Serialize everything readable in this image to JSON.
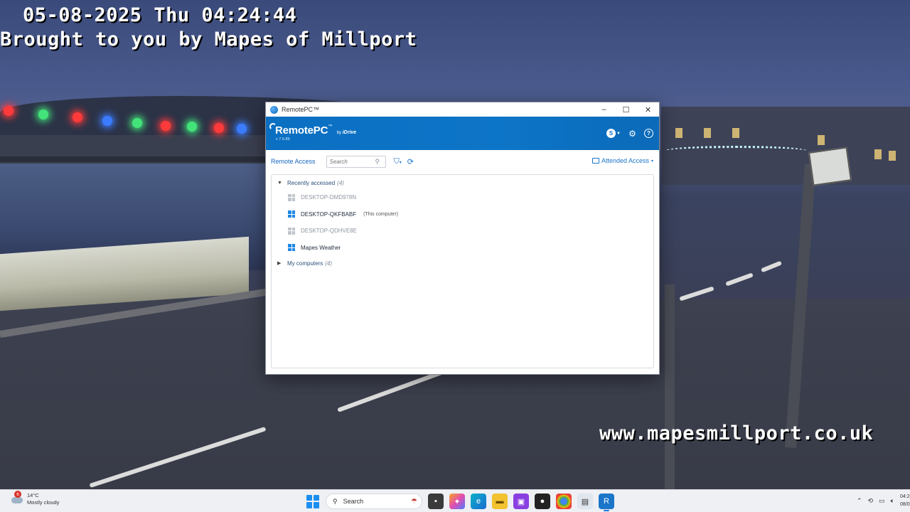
{
  "overlay": {
    "date_time": "05-08-2025 Thu 04:24:44",
    "brand": "Brought to you by Mapes of Millport",
    "url": "www.mapesmillport.co.uk"
  },
  "window": {
    "title": "RemotePC™",
    "controls": [
      "–",
      "☐",
      "✕"
    ],
    "logo": {
      "name": "RemotePC",
      "tm": "™",
      "by": "by",
      "partner": "iDrive",
      "version": "v 7.6.89"
    },
    "account_initial": "S",
    "toolbar": {
      "tab_remote_access": "Remote Access",
      "search_placeholder": "Search",
      "attended_access": "Attended Access"
    },
    "groups": [
      {
        "label": "Recently accessed",
        "count": "(4)",
        "expanded": true,
        "computers": [
          {
            "name": "DESKTOP-DMD978N",
            "tag": "",
            "online": false
          },
          {
            "name": "DESKTOP-QKFBABF",
            "tag": "(This computer)",
            "online": true
          },
          {
            "name": "DESKTOP-QDHVE8E",
            "tag": "",
            "online": false
          },
          {
            "name": "Mapes Weather",
            "tag": "",
            "online": true
          }
        ]
      },
      {
        "label": "My computers",
        "count": "(4)",
        "expanded": false
      }
    ]
  },
  "taskbar": {
    "weather": {
      "temp": "14°C",
      "condition": "Mostly cloudy",
      "badge": "6"
    },
    "search_label": "Search",
    "clock": {
      "time": "04:24",
      "date": "08/05/2025"
    },
    "apps": [
      "explorer-icon",
      "copilot-icon",
      "edge-icon",
      "files-icon",
      "twitch-icon",
      "obs-icon",
      "chrome-icon",
      "notepad-icon",
      "remotepc-icon"
    ]
  },
  "colors": {
    "brand_blue": "#0b6fc2",
    "link_blue": "#1b75c9",
    "taskbar_bg": "#eef0f4"
  }
}
